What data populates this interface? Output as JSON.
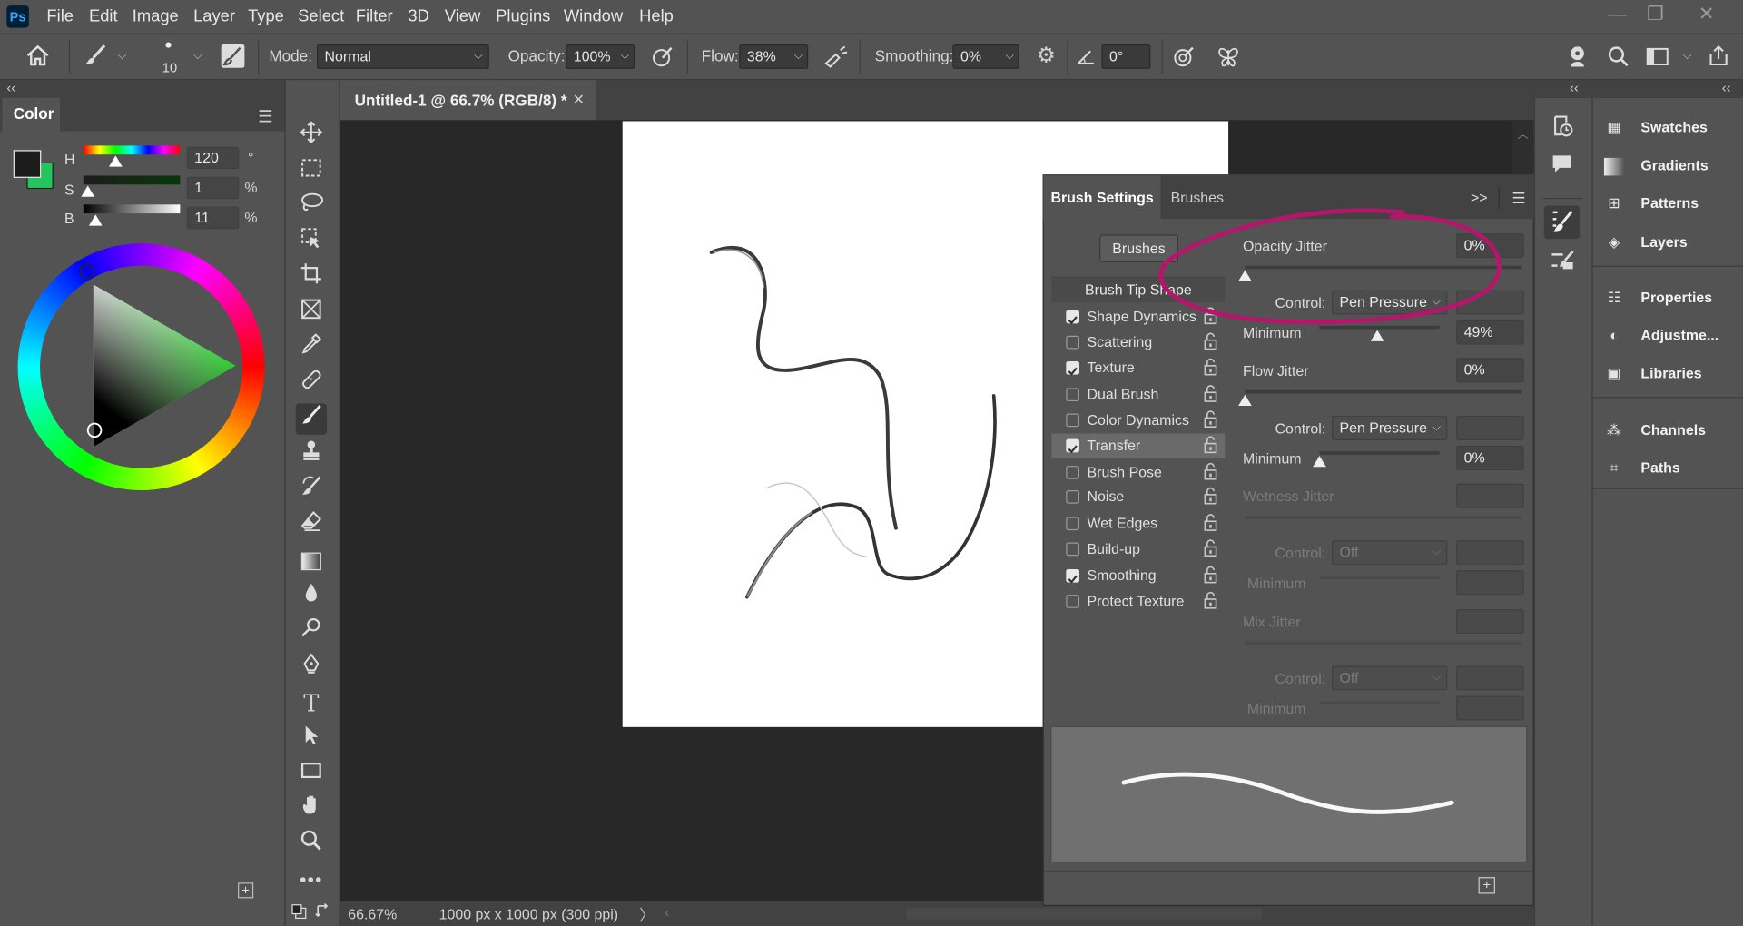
{
  "app": {
    "logo": "Ps"
  },
  "menu": [
    "File",
    "Edit",
    "Image",
    "Layer",
    "Type",
    "Select",
    "Filter",
    "3D",
    "View",
    "Plugins",
    "Window",
    "Help"
  ],
  "window_controls": {
    "minimize": "—",
    "restore": "❐",
    "close": "✕"
  },
  "options": {
    "brush_size": "10",
    "mode_label": "Mode:",
    "mode_value": "Normal",
    "opacity_label": "Opacity:",
    "opacity_value": "100%",
    "flow_label": "Flow:",
    "flow_value": "38%",
    "smoothing_label": "Smoothing:",
    "smoothing_value": "0%",
    "angle_value": "0°"
  },
  "color_panel": {
    "title": "Color",
    "h_label": "H",
    "h_value": "120",
    "h_unit": "°",
    "s_label": "S",
    "s_value": "1",
    "s_unit": "%",
    "b_label": "B",
    "b_value": "11",
    "b_unit": "%",
    "foreground": "#1c1c1c",
    "background": "#22c55e"
  },
  "document": {
    "tab_title": "Untitled-1 @ 66.7% (RGB/8) *",
    "zoom": "66.67%",
    "dimensions": "1000 px x 1000 px (300 ppi)"
  },
  "brush_settings": {
    "tab_active": "Brush Settings",
    "tab_inactive": "Brushes",
    "brushes_button": "Brushes",
    "tip_shape": "Brush Tip Shape",
    "options": [
      {
        "label": "Shape Dynamics",
        "checked": true
      },
      {
        "label": "Scattering",
        "checked": false
      },
      {
        "label": "Texture",
        "checked": true
      },
      {
        "label": "Dual Brush",
        "checked": false
      },
      {
        "label": "Color Dynamics",
        "checked": false
      },
      {
        "label": "Transfer",
        "checked": true
      },
      {
        "label": "Brush Pose",
        "checked": false
      },
      {
        "label": "Noise",
        "checked": false
      },
      {
        "label": "Wet Edges",
        "checked": false
      },
      {
        "label": "Build-up",
        "checked": false
      },
      {
        "label": "Smoothing",
        "checked": true
      },
      {
        "label": "Protect Texture",
        "checked": false
      }
    ],
    "opacity_jitter_label": "Opacity Jitter",
    "opacity_jitter_value": "0%",
    "control_label": "Control:",
    "control_value_1": "Pen Pressure",
    "minimum_label": "Minimum",
    "minimum_value_1": "49%",
    "flow_jitter_label": "Flow Jitter",
    "flow_jitter_value": "0%",
    "control_value_2": "Pen Pressure",
    "minimum_value_2": "0%",
    "wetness_jitter_label": "Wetness Jitter",
    "control_value_3": "Off",
    "mix_jitter_label": "Mix Jitter",
    "control_value_4": "Off",
    "annotation_color": "#b5166b"
  },
  "right_panels": [
    "Swatches",
    "Gradients",
    "Patterns",
    "Layers",
    "Properties",
    "Adjustme...",
    "Libraries",
    "Channels",
    "Paths"
  ],
  "icons": [
    "home-icon",
    "brush-icon",
    "airbrush-icon",
    "gear-icon",
    "butterfly-icon",
    "search-icon",
    "move-tool-icon",
    "marquee-tool-icon",
    "lasso-tool-icon",
    "crop-tool-icon",
    "eyedropper-icon",
    "healing-icon",
    "stamp-icon",
    "eraser-icon",
    "gradient-icon",
    "pen-icon",
    "type-icon",
    "hand-icon",
    "zoom-icon"
  ]
}
